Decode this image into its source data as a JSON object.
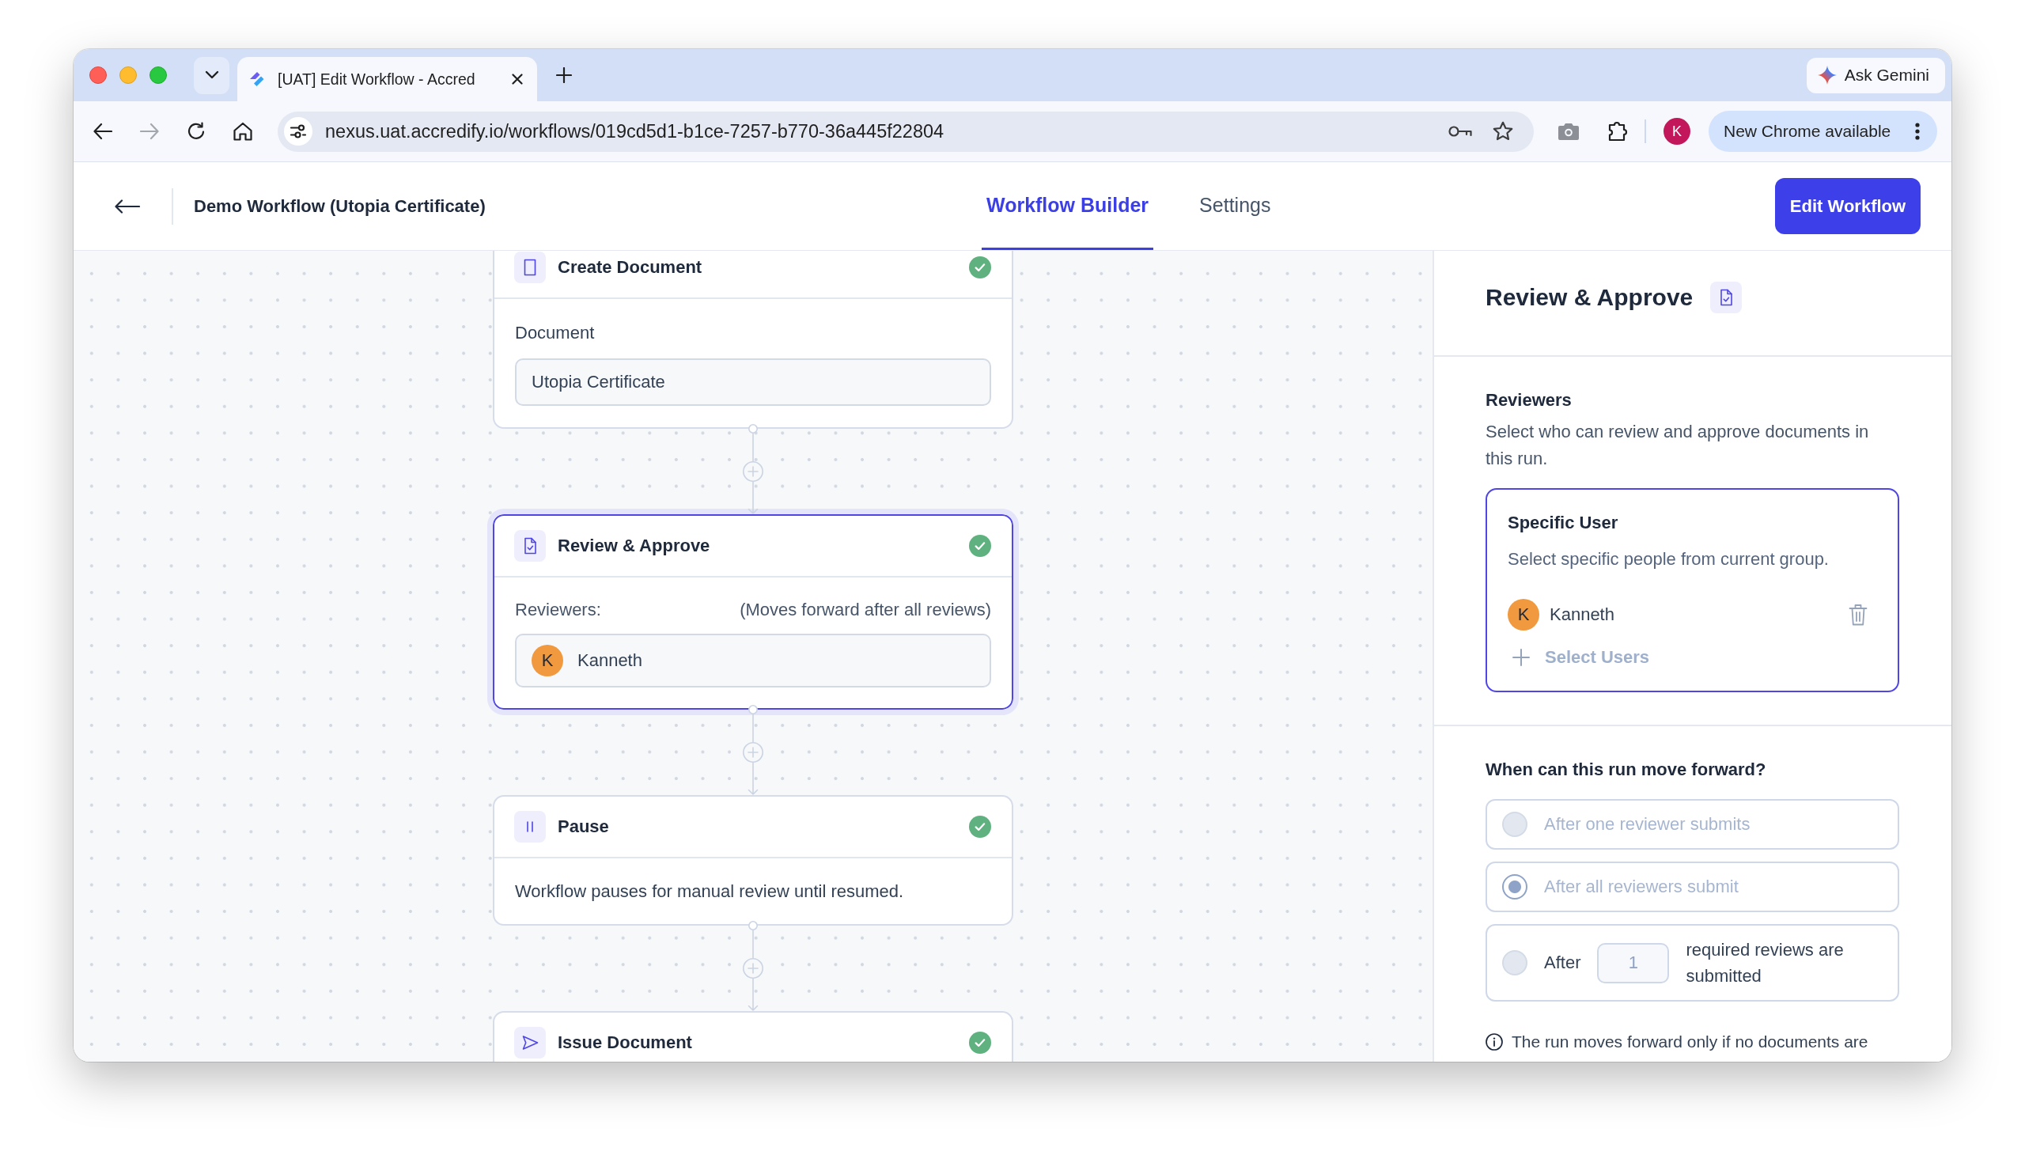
{
  "browser": {
    "tabs": [
      {
        "title": "[UAT] Edit Workflow - Accred",
        "selected": true
      }
    ],
    "ask_button": "Ask Gemini",
    "forward_enabled": false,
    "url": "nexus.uat.accredify.io/workflows/019cd5d1-b1ce-7257-b770-36a445f22804",
    "profile_initial": "K",
    "update_button": "New Chrome available"
  },
  "header": {
    "title": "Demo Workflow (Utopia Certificate)",
    "tabs": [
      {
        "label": "Workflow Builder",
        "selected": true
      },
      {
        "label": "Settings",
        "selected": false
      }
    ],
    "action_button": "Edit Workflow"
  },
  "canvas": {
    "steps": [
      {
        "kind": "document",
        "title": "Create Document",
        "done": true,
        "selected": false,
        "field_label": "Document",
        "field_value": "Utopia Certificate"
      },
      {
        "kind": "review",
        "title": "Review & Approve",
        "done": true,
        "selected": true,
        "label": "Reviewers:",
        "note": "(Moves forward after all reviews)",
        "reviewers": [
          {
            "initial": "K",
            "name": "Kanneth"
          }
        ]
      },
      {
        "kind": "pause",
        "title": "Pause",
        "done": true,
        "selected": false,
        "description": "Workflow pauses for manual review until resumed."
      },
      {
        "kind": "issue",
        "title": "Issue Document",
        "done": true,
        "selected": false
      }
    ]
  },
  "panel": {
    "kind": "review",
    "title": "Review & Approve",
    "reviewers": {
      "heading": "Reviewers",
      "description": "Select who can review and approve documents in this run.",
      "choice": {
        "title": "Specific User",
        "description": "Select specific people from current group.",
        "selected": true,
        "users": [
          {
            "initial": "K",
            "name": "Kanneth"
          }
        ],
        "add_button": "Select Users"
      }
    },
    "forward": {
      "heading": "When can this run move forward?",
      "options": [
        {
          "kind": "simple",
          "label": "After one reviewer submits",
          "selected": false,
          "disabled": true
        },
        {
          "kind": "simple",
          "label": "After all reviewers submit",
          "selected": true,
          "disabled": true
        },
        {
          "kind": "count",
          "label": "After",
          "value": "1",
          "suffix": "required reviews are submitted",
          "selected": false,
          "disabled": false
        }
      ],
      "note": "The run moves forward only if no documents are"
    }
  }
}
